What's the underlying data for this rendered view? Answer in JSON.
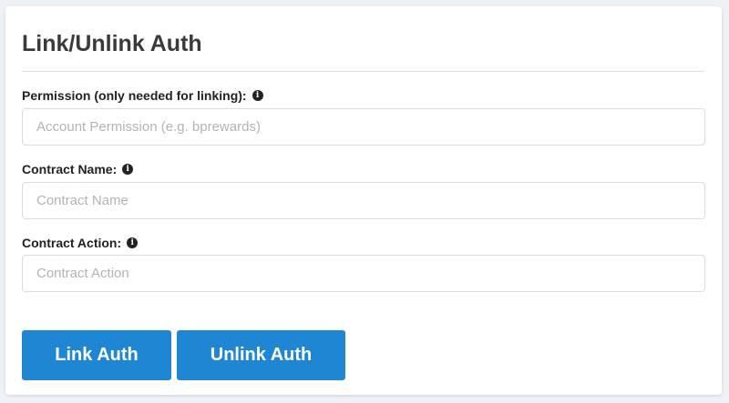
{
  "panel": {
    "title": "Link/Unlink Auth"
  },
  "form": {
    "permission": {
      "label": "Permission (only needed for linking):",
      "icon": "info-icon",
      "placeholder": "Account Permission (e.g. bprewards)",
      "value": ""
    },
    "contract_name": {
      "label": "Contract Name:",
      "icon": "info-icon",
      "placeholder": "Contract Name",
      "value": ""
    },
    "contract_action": {
      "label": "Contract Action:",
      "icon": "info-icon",
      "placeholder": "Contract Action",
      "value": ""
    }
  },
  "actions": {
    "link_label": "Link Auth",
    "unlink_label": "Unlink Auth"
  },
  "colors": {
    "button_bg": "#1f86d4",
    "title_text": "#3a3a3a",
    "page_bg": "#eef1f5"
  }
}
